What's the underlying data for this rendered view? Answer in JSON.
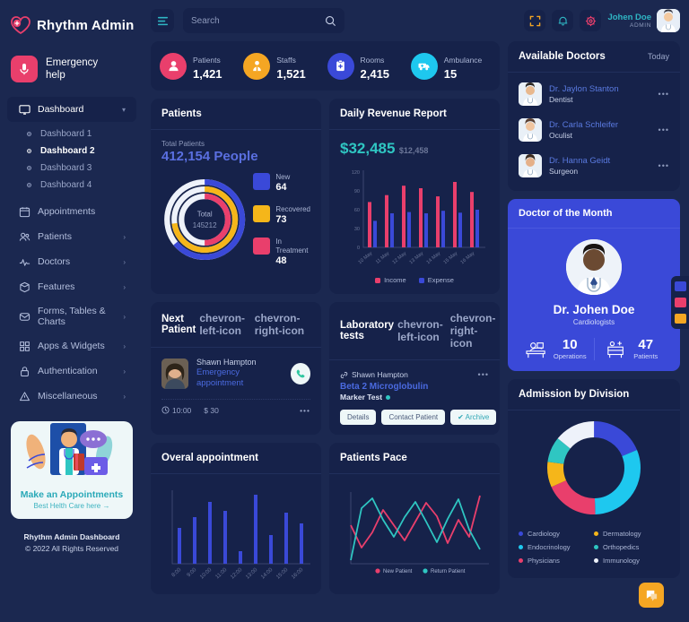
{
  "brand": {
    "name": "Rhythm Admin",
    "logo_icon": "heart-pulse-icon"
  },
  "sidebar": {
    "emergency": {
      "line1": "Emergency",
      "line2": "help",
      "icon": "microphone-icon"
    },
    "dashboard": {
      "label": "Dashboard",
      "icon": "monitor-icon"
    },
    "submenu": [
      {
        "label": "Dashboard 1",
        "active": false
      },
      {
        "label": "Dashboard 2",
        "active": true
      },
      {
        "label": "Dashboard 3",
        "active": false
      },
      {
        "label": "Dashboard 4",
        "active": false
      }
    ],
    "items": [
      {
        "label": "Appointments",
        "icon": "calendar-icon",
        "arrow": ""
      },
      {
        "label": "Patients",
        "icon": "users-icon",
        "arrow": "›"
      },
      {
        "label": "Doctors",
        "icon": "pulse-icon",
        "arrow": "›"
      },
      {
        "label": "Features",
        "icon": "box-icon",
        "arrow": "›"
      },
      {
        "label": "Forms, Tables & Charts",
        "icon": "inbox-icon",
        "arrow": "›"
      },
      {
        "label": "Apps & Widgets",
        "icon": "grid-icon",
        "arrow": "›"
      },
      {
        "label": "Authentication",
        "icon": "lock-icon",
        "arrow": "›"
      },
      {
        "label": "Miscellaneous",
        "icon": "warning-icon",
        "arrow": "›"
      }
    ],
    "promo": {
      "title": "Make an Appointments",
      "subtitle": "Best Helth Care here →"
    },
    "footer": {
      "line1": "Rhythm Admin Dashboard",
      "line2": "© 2022 All Rights Reserved"
    }
  },
  "topbar": {
    "menu_icon": "hamburger-icon",
    "search": {
      "placeholder": "Search",
      "value": ""
    },
    "fullscreen_icon": "fullscreen-icon",
    "bell_icon": "bell-icon",
    "gear_icon": "gear-icon",
    "user": {
      "name": "Johen Doe",
      "role": "ADMIN"
    }
  },
  "stats": [
    {
      "label": "Patients",
      "value": "1,421",
      "color": "#e93f6c",
      "icon": "person-icon"
    },
    {
      "label": "Staffs",
      "value": "1,521",
      "color": "#f5a623",
      "icon": "staff-icon"
    },
    {
      "label": "Rooms",
      "value": "2,415",
      "color": "#3a49d8",
      "icon": "clipboard-icon"
    },
    {
      "label": "Ambulance",
      "value": "15",
      "color": "#1ec8ef",
      "icon": "ambulance-icon"
    }
  ],
  "patients_card": {
    "title": "Patients",
    "total_label": "Total Patients",
    "total_value": "412,154 People",
    "center_label": "Total",
    "center_value": "145212",
    "legend": [
      {
        "name": "New",
        "value": "64",
        "color": "#3a49d8"
      },
      {
        "name": "Recovered",
        "value": "73",
        "color": "#f5b61a"
      },
      {
        "name": "In Treatment",
        "value": "48",
        "color": "#e93f6c"
      }
    ]
  },
  "revenue_card": {
    "title": "Daily Revenue Report",
    "amount": "$32,485",
    "compare": "$12,458"
  },
  "next_patient": {
    "title": "Next Patient",
    "prev_icon": "chevron-left-icon",
    "next_icon": "chevron-right-icon",
    "name": "Shawn Hampton",
    "type": "Emergency appointment",
    "call_icon": "phone-icon",
    "time": "10:00",
    "price": "$ 30",
    "more": "•••"
  },
  "lab_card": {
    "title": "Laboratory tests",
    "prev_icon": "chevron-left-icon",
    "next_icon": "chevron-right-icon",
    "patient": "Shawn Hampton",
    "test": "Beta 2 Microglobulin",
    "marker": "Marker Test",
    "more": "•••",
    "buttons": {
      "details": "Details",
      "contact": "Contact Patient",
      "archive": "✔ Archive"
    }
  },
  "available_doctors": {
    "title": "Available Doctors",
    "filter": "Today",
    "doctors": [
      {
        "name": "Dr. Jaylon Stanton",
        "specialty": "Dentist",
        "more": "•••"
      },
      {
        "name": "Dr. Carla Schleifer",
        "specialty": "Oculist",
        "more": "•••"
      },
      {
        "name": "Dr. Hanna Geidt",
        "specialty": "Surgeon",
        "more": "•••"
      }
    ]
  },
  "doctor_of_month": {
    "title": "Doctor of the Month",
    "name": "Dr. Johen Doe",
    "specialty": "Cardiologists",
    "stats": [
      {
        "value": "10",
        "label": "Operations",
        "icon": "surgery-icon"
      },
      {
        "value": "47",
        "label": "Patients",
        "icon": "hospital-bed-icon"
      }
    ]
  },
  "admission_card": {
    "title": "Admission by Division",
    "legend": [
      {
        "name": "Cardiology",
        "color": "#3a49d8"
      },
      {
        "name": "Dermatology",
        "color": "#f5b61a"
      },
      {
        "name": "Endocrinology",
        "color": "#1ec8ef"
      },
      {
        "name": "Orthopedics",
        "color": "#2fc6c2"
      },
      {
        "name": "Physicians",
        "color": "#e93f6c"
      },
      {
        "name": "Immunology",
        "color": "#eef2fa"
      }
    ]
  },
  "overall_card": {
    "title": "Overal appointment"
  },
  "pace_card": {
    "title": "Patients Pace"
  },
  "floatbar": [
    {
      "name": "widget-blue",
      "color": "#3a49d8"
    },
    {
      "name": "widget-pink",
      "color": "#e93f6c"
    },
    {
      "name": "widget-orange",
      "color": "#f5a623"
    }
  ],
  "chat_fab": {
    "icon": "chat-icon",
    "color": "#f5a623"
  },
  "chart_data": [
    {
      "id": "patients-donut",
      "type": "pie",
      "title": "Patients",
      "labels": [
        "New",
        "Recovered",
        "In Treatment"
      ],
      "values": [
        64,
        73,
        48
      ],
      "colors": [
        "#3a49d8",
        "#f5b61a",
        "#e93f6c"
      ],
      "center_label": "Total",
      "center_value": "145212",
      "rings": 3,
      "legend": "right"
    },
    {
      "id": "daily-revenue",
      "type": "bar",
      "title": "Daily Revenue Report",
      "categories": [
        "10 May",
        "11 May",
        "12 May",
        "13 May",
        "14 May",
        "15 May",
        "16 May"
      ],
      "series": [
        {
          "name": "Income",
          "color": "#e93f6c",
          "values": [
            72,
            83,
            98,
            94,
            81,
            104,
            88
          ]
        },
        {
          "name": "Expense",
          "color": "#3a49d8",
          "values": [
            42,
            54,
            56,
            54,
            58,
            55,
            60
          ]
        }
      ],
      "ylim": [
        0,
        120
      ],
      "yticks": [
        0,
        30,
        60,
        90,
        120
      ],
      "xlabel": "",
      "ylabel": "",
      "grid": false,
      "legend": "bottom"
    },
    {
      "id": "overall-appointment",
      "type": "bar",
      "title": "Overal appointment",
      "categories": [
        "8:00",
        "9:00",
        "10:00",
        "11:00",
        "12:00",
        "13:00",
        "14:00",
        "15:00",
        "16:00"
      ],
      "values": [
        48,
        62,
        82,
        70,
        17,
        92,
        38,
        68,
        53
      ],
      "color": "#3a49d8",
      "ylim": [
        0,
        100
      ],
      "grid": false,
      "legend": "none"
    },
    {
      "id": "patients-pace",
      "type": "line",
      "title": "Patients Pace",
      "x": [
        0,
        1,
        2,
        3,
        4,
        5,
        6,
        7,
        8,
        9,
        10,
        11,
        12
      ],
      "series": [
        {
          "name": "New Patient",
          "color": "#e93f6c",
          "values": [
            48,
            20,
            40,
            70,
            48,
            28,
            52,
            78,
            58,
            30,
            56,
            34,
            88
          ]
        },
        {
          "name": "Return Patient",
          "color": "#2fc6c2",
          "values": [
            5,
            72,
            88,
            52,
            30,
            58,
            80,
            48,
            26,
            54,
            78,
            44,
            18
          ]
        }
      ],
      "grid": false,
      "legend": "bottom"
    },
    {
      "id": "admission-by-division",
      "type": "pie",
      "title": "Admission by Division",
      "labels": [
        "Cardiology",
        "Endocrinology",
        "Physicians",
        "Dermatology",
        "Orthopedics",
        "Immunology"
      ],
      "values": [
        17,
        28,
        17,
        8,
        8,
        13
      ],
      "colors": [
        "#3a49d8",
        "#1ec8ef",
        "#e93f6c",
        "#f5b61a",
        "#2fc6c2",
        "#eef2fa"
      ],
      "legend": "bottom"
    }
  ]
}
